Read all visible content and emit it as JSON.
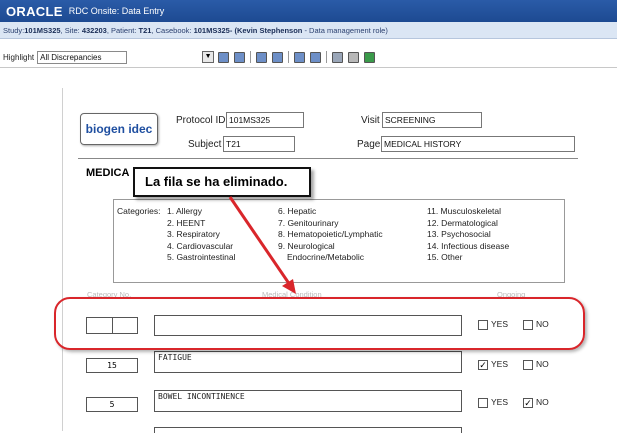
{
  "window": {
    "logo": "ORACLE",
    "app_title": "RDC Onsite: Data Entry"
  },
  "study_bar": {
    "text_parts": [
      {
        "t": "Study:",
        "b": false
      },
      {
        "t": "101MS325",
        "b": true
      },
      {
        "t": ", Site: ",
        "b": false
      },
      {
        "t": "432203",
        "b": true
      },
      {
        "t": ", Patient: ",
        "b": false
      },
      {
        "t": "T21",
        "b": true
      },
      {
        "t": ", Casebook: ",
        "b": false
      },
      {
        "t": "101MS325-",
        "b": true
      },
      {
        "t": " (Kevin Stephenson",
        "b": true
      },
      {
        "t": " - Data management role)",
        "b": false
      }
    ]
  },
  "toolbar": {
    "highlight_label": "Highlight",
    "highlight_value": "All Discrepancies",
    "dropdown_arrow": "▼"
  },
  "form": {
    "logo_text": "biogen idec",
    "protocol_label": "Protocol ID",
    "protocol_value": "101MS325",
    "visit_label": "Visit",
    "visit_value": "SCREENING",
    "subject_label": "Subject",
    "subject_value": "T21",
    "page_label": "Page",
    "page_value": "MEDICAL HISTORY",
    "section_title": "MEDICA",
    "categories_label": "Categories:",
    "categories": [
      "1. Allergy",
      "2. HEENT",
      "3. Respiratory",
      "4. Cardiovascular",
      "5. Gastrointestinal",
      "6. Hepatic",
      "7. Genitourinary",
      "8. Hematopoietic/Lymphatic",
      "9. Neurological",
      "Endocrine/Metabolic",
      "11. Musculoskeletal",
      "12. Dermatological",
      "13. Psychosocial",
      "14. Infectious disease",
      "15. Other"
    ],
    "col_headers": {
      "category": "Category No.",
      "condition": "Medical Condition",
      "ongoing": "Ongoing"
    },
    "rows": [
      {
        "seq": "",
        "condition": "",
        "yes_checked": false,
        "no_checked": false
      },
      {
        "seq": "15",
        "condition": "FATIGUE",
        "yes_checked": true,
        "no_checked": false
      },
      {
        "seq": "5",
        "condition": "BOWEL INCONTINENCE",
        "yes_checked": false,
        "no_checked": true
      }
    ],
    "yes_label": "YES",
    "no_label": "NO",
    "check_mark": "✓"
  },
  "callout": {
    "text": "La fila se ha eliminado."
  },
  "colors": {
    "title_bar": "#1d4a92",
    "highlight_ring": "#d9262b",
    "arrow": "#d9262b"
  }
}
